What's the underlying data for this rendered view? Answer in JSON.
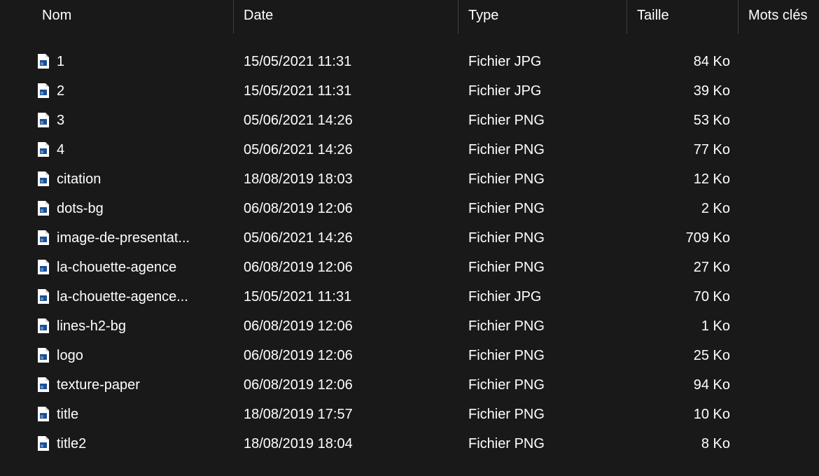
{
  "colors": {
    "background": "#191919",
    "text": "#ffffff",
    "separator": "#3f3f3f",
    "icon_body": "#ffffff",
    "icon_image": "#1d4f91"
  },
  "columns": {
    "name": "Nom",
    "date": "Date",
    "type": "Type",
    "size": "Taille",
    "keywords": "Mots clés"
  },
  "files": [
    {
      "name": "1",
      "date": "15/05/2021 11:31",
      "type": "Fichier JPG",
      "size": "84 Ko",
      "icon": "image-file-icon"
    },
    {
      "name": "2",
      "date": "15/05/2021 11:31",
      "type": "Fichier JPG",
      "size": "39 Ko",
      "icon": "image-file-icon"
    },
    {
      "name": "3",
      "date": "05/06/2021 14:26",
      "type": "Fichier PNG",
      "size": "53 Ko",
      "icon": "image-file-icon"
    },
    {
      "name": "4",
      "date": "05/06/2021 14:26",
      "type": "Fichier PNG",
      "size": "77 Ko",
      "icon": "image-file-icon"
    },
    {
      "name": "citation",
      "date": "18/08/2019 18:03",
      "type": "Fichier PNG",
      "size": "12 Ko",
      "icon": "image-file-icon"
    },
    {
      "name": "dots-bg",
      "date": "06/08/2019 12:06",
      "type": "Fichier PNG",
      "size": "2 Ko",
      "icon": "image-file-icon"
    },
    {
      "name": "image-de-presentat...",
      "date": "05/06/2021 14:26",
      "type": "Fichier PNG",
      "size": "709 Ko",
      "icon": "image-file-icon"
    },
    {
      "name": "la-chouette-agence",
      "date": "06/08/2019 12:06",
      "type": "Fichier PNG",
      "size": "27 Ko",
      "icon": "image-file-icon"
    },
    {
      "name": "la-chouette-agence...",
      "date": "15/05/2021 11:31",
      "type": "Fichier JPG",
      "size": "70 Ko",
      "icon": "image-file-icon"
    },
    {
      "name": "lines-h2-bg",
      "date": "06/08/2019 12:06",
      "type": "Fichier PNG",
      "size": "1 Ko",
      "icon": "image-file-icon"
    },
    {
      "name": "logo",
      "date": "06/08/2019 12:06",
      "type": "Fichier PNG",
      "size": "25 Ko",
      "icon": "image-file-icon"
    },
    {
      "name": "texture-paper",
      "date": "06/08/2019 12:06",
      "type": "Fichier PNG",
      "size": "94 Ko",
      "icon": "image-file-icon"
    },
    {
      "name": "title",
      "date": "18/08/2019 17:57",
      "type": "Fichier PNG",
      "size": "10 Ko",
      "icon": "image-file-icon"
    },
    {
      "name": "title2",
      "date": "18/08/2019 18:04",
      "type": "Fichier PNG",
      "size": "8 Ko",
      "icon": "image-file-icon"
    }
  ]
}
